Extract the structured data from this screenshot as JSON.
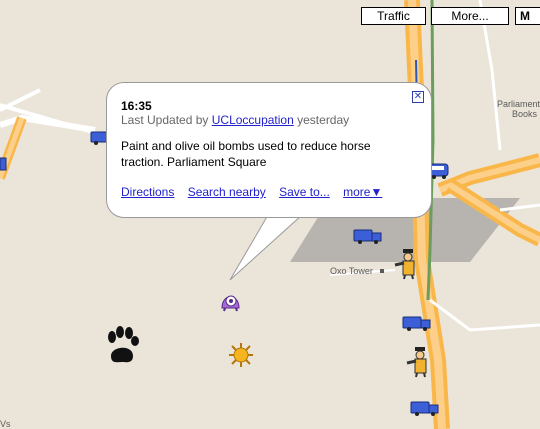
{
  "controls": {
    "traffic_label": "Traffic",
    "more_label": "More...",
    "map_type_label": "M"
  },
  "map_labels": {
    "parliament_label_line1": "Parliament",
    "parliament_label_line2": "Books",
    "oxo_tower": "Oxo Tower",
    "corner_text": "Vs"
  },
  "info_window": {
    "time": "16:35",
    "last_updated_prefix": "Last Updated by ",
    "user": "UCLoccupation",
    "last_updated_suffix": " yesterday",
    "description": "Paint and olive oil bombs used to reduce horse traction. Parliament Square",
    "links": {
      "directions": "Directions",
      "search_nearby": "Search nearby",
      "save_to": "Save to...",
      "more": "more▼"
    }
  },
  "markers": [
    {
      "type": "van-icon"
    },
    {
      "type": "van-icon"
    },
    {
      "type": "van-icon"
    },
    {
      "type": "van-icon"
    },
    {
      "type": "van-icon"
    },
    {
      "type": "police-officer-icon"
    },
    {
      "type": "police-officer-icon"
    },
    {
      "type": "paw-print-icon"
    },
    {
      "type": "sun-icon"
    },
    {
      "type": "purple-alien-icon"
    }
  ]
}
